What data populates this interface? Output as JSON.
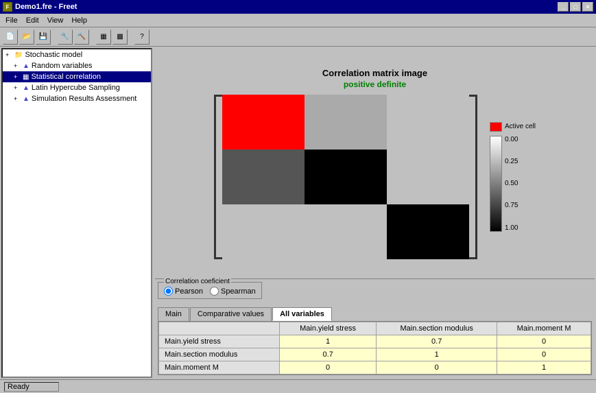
{
  "titleBar": {
    "title": "Demo1.fre - Freet",
    "appIcon": "F",
    "controls": [
      "_",
      "□",
      "×"
    ]
  },
  "menuBar": {
    "items": [
      "File",
      "Edit",
      "View",
      "Help"
    ]
  },
  "toolbar": {
    "buttons": [
      "📄",
      "📂",
      "💾",
      "🔧",
      "🔨",
      "📊",
      "📈",
      "?"
    ]
  },
  "tree": {
    "items": [
      {
        "id": "stochastic-model",
        "label": "Stochastic model",
        "indent": 1,
        "icon": "folder",
        "expand": "+"
      },
      {
        "id": "random-variables",
        "label": "Random variables",
        "indent": 2,
        "icon": "triangle"
      },
      {
        "id": "statistical-correlation",
        "label": "Statistical correlation",
        "indent": 2,
        "icon": "grid",
        "selected": true
      },
      {
        "id": "latin-hypercube",
        "label": "Latin Hypercube Sampling",
        "indent": 2,
        "icon": "chart"
      },
      {
        "id": "simulation-results",
        "label": "Simulation Results Assessment",
        "indent": 2,
        "icon": "chart"
      }
    ]
  },
  "matrixArea": {
    "title": "Correlation matrix image",
    "subtitle": "positive definite"
  },
  "legend": {
    "activeCell": "Active cell",
    "scaleLabels": [
      "0.00",
      "0.25",
      "0.50",
      "0.75",
      "1.00"
    ]
  },
  "correlationCoeff": {
    "groupLabel": "Correlation coeficient",
    "options": [
      "Pearson",
      "Spearman"
    ],
    "selected": "Pearson"
  },
  "tabs": {
    "items": [
      "Main",
      "Comparative values",
      "All variables"
    ],
    "active": "All variables"
  },
  "table": {
    "columns": [
      "",
      "Main.yield stress",
      "Main.section modulus",
      "Main.moment M"
    ],
    "rows": [
      {
        "label": "Main.yield stress",
        "values": [
          "1",
          "0.7",
          "0"
        ]
      },
      {
        "label": "Main.section modulus",
        "values": [
          "0.7",
          "1",
          "0"
        ]
      },
      {
        "label": "Main.moment M",
        "values": [
          "0",
          "0",
          "1"
        ]
      }
    ]
  },
  "statusBar": {
    "text": "Ready"
  }
}
